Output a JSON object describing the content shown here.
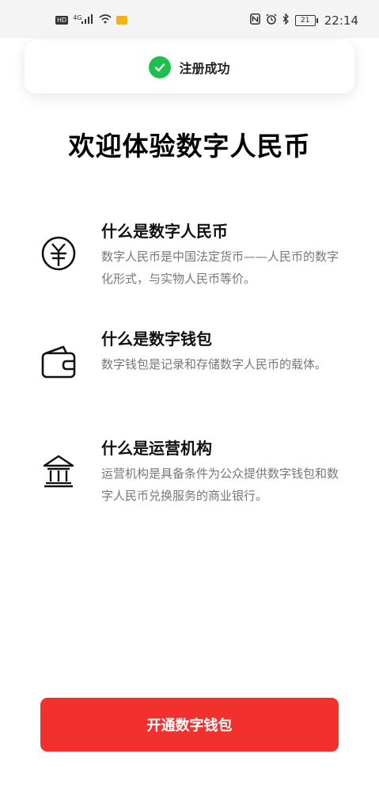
{
  "status_bar": {
    "left_badge": "HD",
    "network": "4G",
    "battery": "21",
    "time": "22:14"
  },
  "toast": {
    "text": "注册成功"
  },
  "title": "欢迎体验数字人民币",
  "sections": [
    {
      "icon": "rmb-coin-icon",
      "title": "什么是数字人民币",
      "desc": "数字人民币是中国法定货币——人民币的数字化形式，与实物人民币等价。"
    },
    {
      "icon": "wallet-icon",
      "title": "什么是数字钱包",
      "desc": "数字钱包是记录和存储数字人民币的载体。"
    },
    {
      "icon": "bank-icon",
      "title": "什么是运营机构",
      "desc": "运营机构是具备条件为公众提供数字钱包和数字人民币兑换服务的商业银行。"
    }
  ],
  "cta": {
    "label": "开通数字钱包"
  },
  "colors": {
    "accent": "#f2312f",
    "success": "#1fbf4e"
  }
}
